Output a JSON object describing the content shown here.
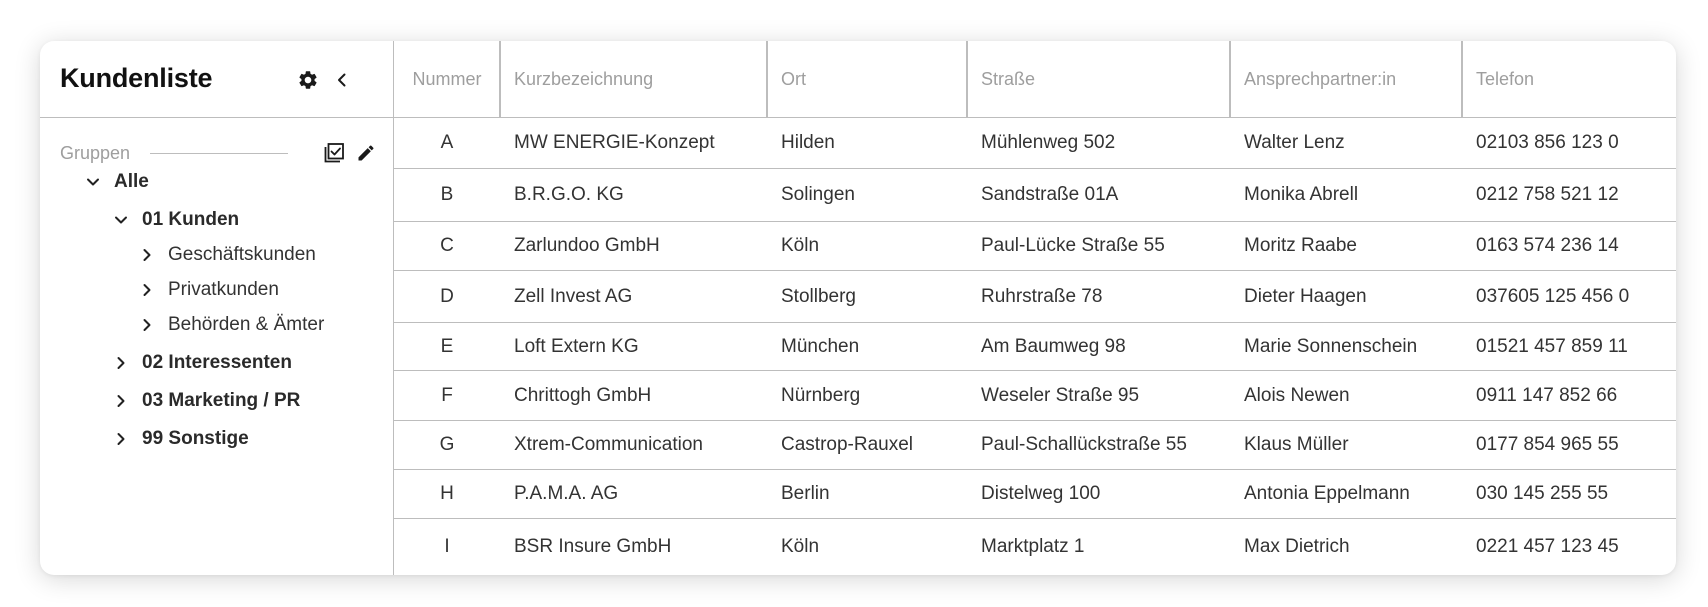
{
  "sidebar": {
    "title": "Kundenliste",
    "settings_icon": "gear-icon",
    "collapse_icon": "chevron-left-icon",
    "groups_label": "Gruppen",
    "select_icon": "checkbox-list-icon",
    "edit_icon": "pencil-icon",
    "tree": [
      {
        "label": "Alle",
        "expanded": true,
        "level": 0,
        "bold": true
      },
      {
        "label": "01 Kunden",
        "expanded": true,
        "level": 1,
        "bold": true
      },
      {
        "label": "Geschäftskunden",
        "expanded": false,
        "level": 2,
        "bold": false
      },
      {
        "label": "Privatkunden",
        "expanded": false,
        "level": 2,
        "bold": false
      },
      {
        "label": "Behörden & Ämter",
        "expanded": false,
        "level": 2,
        "bold": false
      },
      {
        "label": "02 Interessenten",
        "expanded": false,
        "level": 1,
        "bold": true
      },
      {
        "label": "03 Marketing / PR",
        "expanded": false,
        "level": 1,
        "bold": true
      },
      {
        "label": "99 Sonstige",
        "expanded": false,
        "level": 1,
        "bold": true
      }
    ]
  },
  "table": {
    "columns": [
      "Nummer",
      "Kurzbezeichnung",
      "Ort",
      "Straße",
      "Ansprechpartner:in",
      "Telefon"
    ],
    "rows": [
      [
        "A",
        "MW ENERGIE-Konzept",
        "Hilden",
        "Mühlenweg 502",
        "Walter Lenz",
        "02103 856 123 0"
      ],
      [
        "B",
        "B.R.G.O. KG",
        "Solingen",
        "Sandstraße 01A",
        "Monika Abrell",
        "0212 758 521 12"
      ],
      [
        "C",
        "Zarlundoo GmbH",
        "Köln",
        "Paul-Lücke Straße 55",
        "Moritz Raabe",
        "0163 574 236 14"
      ],
      [
        "D",
        "Zell Invest AG",
        "Stollberg",
        "Ruhrstraße 78",
        "Dieter Haagen",
        "037605 125 456 0"
      ],
      [
        "E",
        "Loft Extern KG",
        "München",
        "Am Baumweg 98",
        "Marie Sonnenschein",
        "01521 457 859 11"
      ],
      [
        "F",
        "Chrittogh GmbH",
        "Nürnberg",
        "Weseler Straße 95",
        "Alois Newen",
        "0911 147 852 66"
      ],
      [
        "G",
        "Xtrem-Communication",
        "Castrop-Rauxel",
        "Paul-Schallückstraße 55",
        "Klaus Müller",
        "0177 854 965 55"
      ],
      [
        "H",
        "P.A.M.A. AG",
        "Berlin",
        "Distelweg 100",
        "Antonia Eppelmann",
        "030 145 255 55"
      ],
      [
        "I",
        "BSR Insure GmbH",
        "Köln",
        "Marktplatz 1",
        "Max Dietrich",
        "0221 457 123 45"
      ]
    ]
  }
}
